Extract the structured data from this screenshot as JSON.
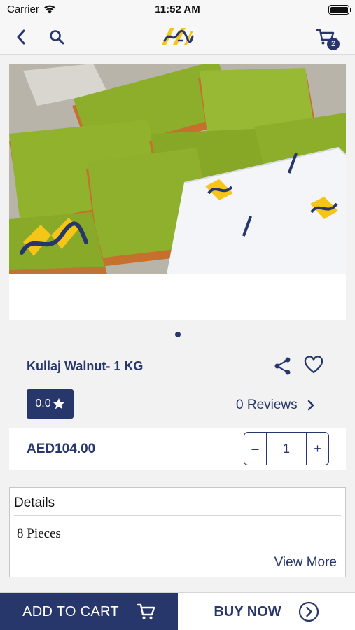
{
  "status_bar": {
    "carrier": "Carrier",
    "time": "11:52 AM"
  },
  "nav": {
    "cart_count": "2"
  },
  "product": {
    "title": "Kullaj Walnut- 1 KG",
    "rating": "0.0",
    "reviews_label": "0 Reviews",
    "price": "AED104.00",
    "quantity": "1",
    "stepper_minus": "–",
    "stepper_plus": "+"
  },
  "details": {
    "heading": "Details",
    "body": "8 Pieces",
    "view_more": "View More"
  },
  "actions": {
    "add_to_cart": "ADD TO CART",
    "buy_now": "BUY NOW"
  },
  "colors": {
    "brand": "#27366b",
    "accent": "#f5c518",
    "pistachio": "#8cae2a"
  }
}
